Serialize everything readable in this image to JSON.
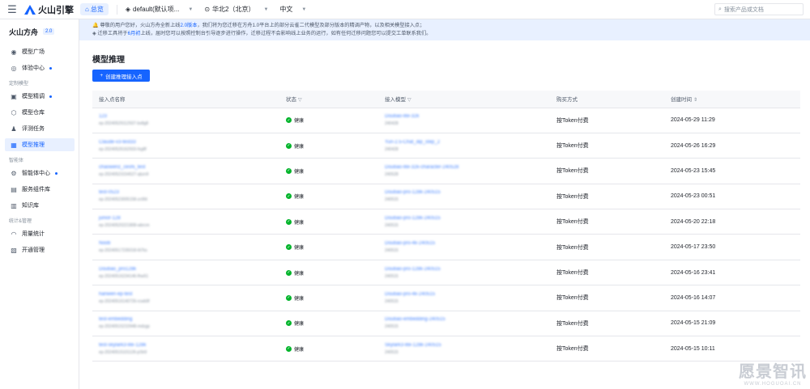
{
  "topbar": {
    "brand": "火山引擎",
    "home": "总览",
    "project": "default(默认项...",
    "region": "华北2（北京）",
    "language": "中文",
    "search_placeholder": "搜索产品或文档"
  },
  "sidebar": {
    "title": "火山方舟",
    "version": "2.0",
    "groups": [
      "定制模型",
      "智能体",
      "统计&管理"
    ],
    "items": [
      {
        "label": "模型广场"
      },
      {
        "label": "体验中心"
      },
      {
        "label": "模型精调"
      },
      {
        "label": "模型仓库"
      },
      {
        "label": "评测任务"
      },
      {
        "label": "模型推理"
      },
      {
        "label": "智能体中心"
      },
      {
        "label": "服务组件库"
      },
      {
        "label": "知识库"
      },
      {
        "label": "用量统计"
      },
      {
        "label": "开通管理"
      }
    ]
  },
  "notice": {
    "line1_a": "尊敬的用户您好，火山方舟全新上线",
    "line1_hl": "2.0版本",
    "line1_b": "，我们将为您迁移在方舟1.0平台上的部分云雀二代模型及部分版本的精调产物，以及相关模型接入点；",
    "line2_a": "迁移工具将于",
    "line2_hl": "6月初",
    "line2_b": "上线，届时您可以按照控制台引导逐步进行操作，迁移过程不会影响线上业务的运行，如有任何迁移问题您可以提交工单联系我们。"
  },
  "page": {
    "title": "模型推理",
    "create_button": "创建推理接入点"
  },
  "table": {
    "headers": [
      "接入点名称",
      "状态",
      "接入模型",
      "购买方式",
      "创建时间"
    ],
    "rows": [
      {
        "name": "123",
        "id": "ep-20240529112937-bx8g8",
        "status": "健康",
        "model": "Doubao-lite-32k",
        "model_ver": "240428",
        "purchase": "按Token付费",
        "created": "2024-05-29 11:29"
      },
      {
        "name": "Claude-v3-test33",
        "id": "ep-20240526162933-fxg8f",
        "status": "健康",
        "model": "Yun-2.5-Chat_dip_step_2",
        "model_ver": "240428",
        "purchase": "按Token付费",
        "created": "2024-05-26 16:29"
      },
      {
        "name": "chaowenz_ceshi_test",
        "id": "ep-20240523154527-qbzn9",
        "status": "健康",
        "model": "Doubao-lite-32k-character-240528",
        "model_ver": "240528",
        "purchase": "按Token付费",
        "created": "2024-05-23 15:45"
      },
      {
        "name": "test-0523",
        "id": "ep-20240523005158-zc6fd",
        "status": "健康",
        "model": "Doubao-pro-128k-240515",
        "model_ver": "240515",
        "purchase": "按Token付费",
        "created": "2024-05-23 00:51"
      },
      {
        "name": "junior-128",
        "id": "ep-20240520221808-wbrcm",
        "status": "健康",
        "model": "Doubao-pro-128k-240515",
        "model_ver": "240515",
        "purchase": "按Token付费",
        "created": "2024-05-20 22:18"
      },
      {
        "name": "Noob",
        "id": "ep-20240517235018-6t7ks",
        "status": "健康",
        "model": "Doubao-pro-4k-240515",
        "model_ver": "240515",
        "purchase": "按Token付费",
        "created": "2024-05-17 23:50"
      },
      {
        "name": "Doubao_pro128k",
        "id": "ep-20240516234146-fhw51",
        "status": "健康",
        "model": "Doubao-pro-128k-240515",
        "model_ver": "240515",
        "purchase": "按Token付费",
        "created": "2024-05-16 23:41"
      },
      {
        "name": "hanwen-ep-test",
        "id": "ep-20240516140726-rcwb9f",
        "status": "健康",
        "model": "Doubao-pro-4k-240515",
        "model_ver": "240515",
        "purchase": "按Token付费",
        "created": "2024-05-16 14:07"
      },
      {
        "name": "test-embedding",
        "id": "ep-20240515210948-mdzgp",
        "status": "健康",
        "model": "Doubao-embedding-240515",
        "model_ver": "240515",
        "purchase": "按Token付费",
        "created": "2024-05-15 21:09"
      },
      {
        "name": "test-skylark3-lite-128k",
        "id": "ep-20240515101126-jc5k9",
        "status": "健康",
        "model": "Skylark3-lite-128k-240515",
        "model_ver": "240515",
        "purchase": "按Token付费",
        "created": "2024-05-15 10:11"
      }
    ]
  },
  "watermark": {
    "main": "愿景智讯",
    "sub": "WWW.HOGUOAI.CN"
  }
}
